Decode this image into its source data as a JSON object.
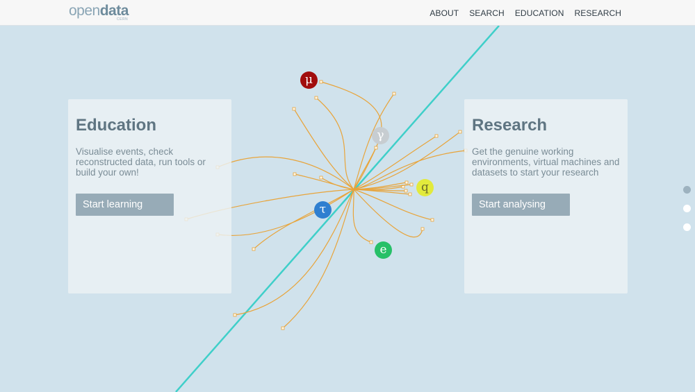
{
  "header": {
    "logo_main": "open",
    "logo_bold": "data",
    "logo_sub": "CERN",
    "nav": [
      "ABOUT",
      "SEARCH",
      "EDUCATION",
      "RESEARCH"
    ]
  },
  "education": {
    "title": "Education",
    "text": "Visualise events, check reconstructed data, run tools or build your own!",
    "button": "Start learning"
  },
  "research": {
    "title": "Research",
    "text": "Get the genuine working environments, virtual machines and datasets to start your research",
    "button": "Start analysing"
  },
  "particles": [
    {
      "symbol": "μ",
      "name": "muon",
      "color": "#a10d0d"
    },
    {
      "symbol": "γ",
      "name": "photon",
      "color": "#c7cdd1"
    },
    {
      "symbol": "q",
      "name": "quark",
      "color": "#e2ea3c"
    },
    {
      "symbol": "τ",
      "name": "tau",
      "color": "#2f7fd0"
    },
    {
      "symbol": "e",
      "name": "electron",
      "color": "#27c068"
    }
  ],
  "colors": {
    "beam": "#3fcfc9",
    "track": "#e8a43a",
    "background": "#d0e2ec"
  },
  "pager": {
    "count": 3,
    "active": 0
  }
}
